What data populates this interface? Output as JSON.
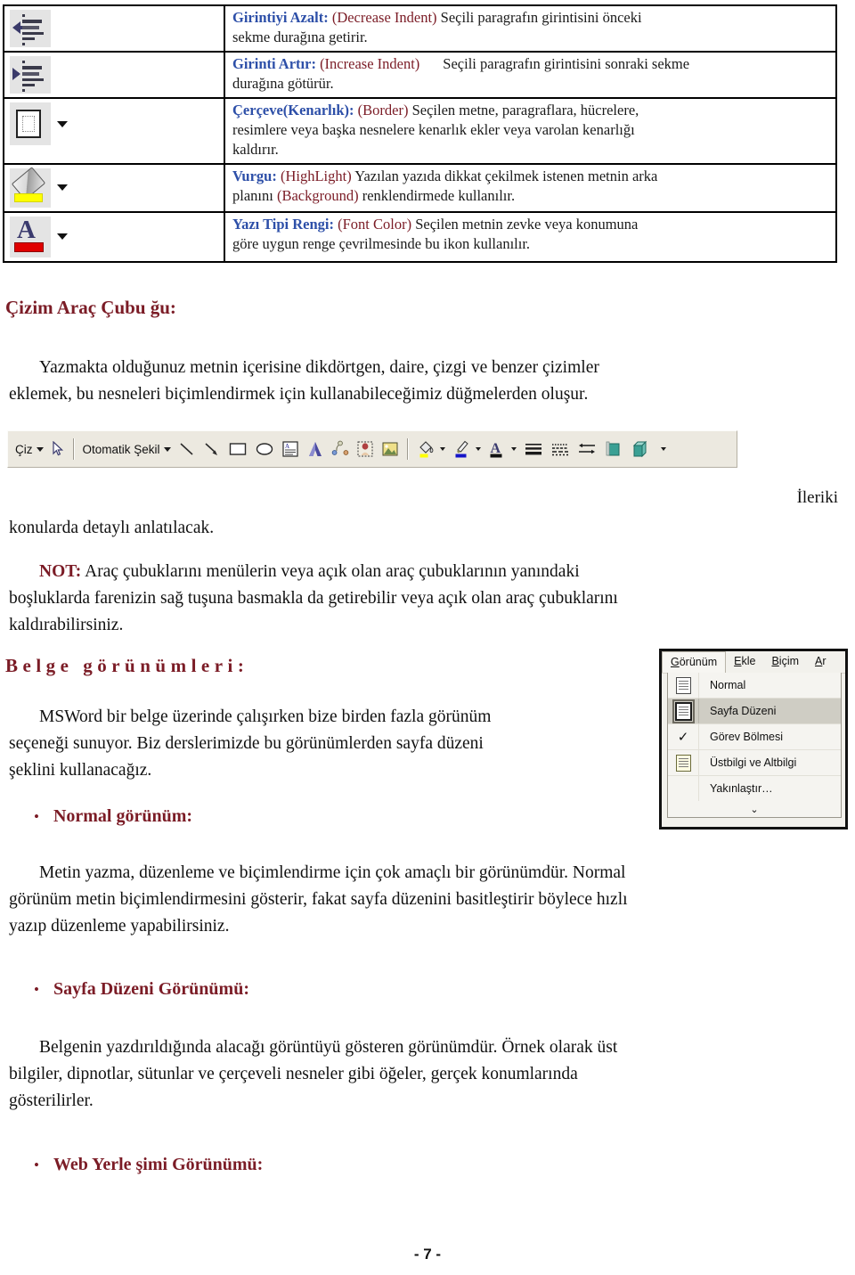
{
  "icon_table": {
    "rows": [
      {
        "icon": "decrease-indent-icon",
        "label_tr": "Girintiyi Azalt:",
        "label_en": "(Decrease Indent)",
        "desc_part1": " Seçili paragrafın girintisini önceki",
        "desc_part2": "sekme durağına getirir.",
        "has_caret": false
      },
      {
        "icon": "increase-indent-icon",
        "label_tr": "Girinti Artır:",
        "label_en": "(Increase Indent)",
        "desc_part1": "Seçili paragrafın girintisini sonraki sekme",
        "desc_part2": "durağına götürür.",
        "has_caret": false,
        "wide_gap": true
      },
      {
        "icon": "border-icon",
        "label_tr": "Çerçeve(Kenarlık):",
        "label_en": "(Border)",
        "desc_part1": " Seçilen metne, paragraflara, hücrelere,",
        "desc_part2": "resimlere veya başka nesnelere kenarlık ekler veya varolan kenarlığı",
        "desc_part3": "kaldırır.",
        "has_caret": true
      },
      {
        "icon": "highlight-icon",
        "label_tr": "Vurgu:",
        "label_en": "(HighLight)",
        "desc_part1": " Yazılan yazıda dikkat çekilmek istenen metnin arka",
        "desc_part2_pre": "planını ",
        "desc_part2_red": "(Background)",
        "desc_part2_post": " renklendirmede kullanılır.",
        "has_caret": true
      },
      {
        "icon": "font-color-icon",
        "label_tr": "Yazı Tipi Rengi:",
        "label_en": "(Font Color)",
        "desc_part1": " Seçilen metnin zevke veya konumuna",
        "desc_part2": "göre uygun renge çevrilmesinde bu ikon kullanılır.",
        "has_caret": true
      }
    ]
  },
  "sections": {
    "drawing_heading": "Çizim Araç Çubu ğu:",
    "drawing_para_line1": "Yazmakta olduğunuz metnin içerisine dikdörtgen, daire, çizgi ve benzer çizimler",
    "drawing_para_line2": "eklemek, bu nesneleri biçimlendirmek için kullanabileceğimiz düğmelerden oluşur.",
    "ileriki": "İleriki",
    "konularda": "konularda detaylı anlatılacak.",
    "not_label": "NOT:",
    "not_line1": " Araç çubuklarını menülerin veya açık olan araç çubuklarının yanındaki",
    "not_line2": "boşluklarda farenizin sağ tuşuna basmakla da getirebilir veya açık olan araç çubuklarını",
    "not_line3": "kaldırabilirsiniz.",
    "belge_heading": "Belge görünümleri:",
    "belge_line1": "MSWord bir belge üzerinde çalışırken bize birden fazla görünüm",
    "belge_line2": "seçeneği sunuyor. Biz derslerimizde bu görünümlerden sayfa düzeni",
    "belge_line3": "şeklini kullanacağız.",
    "normal_bullet": "Normal görünüm:",
    "normal_line1": "Metin yazma, düzenleme ve biçimlendirme için çok amaçlı bir görünümdür. Normal",
    "normal_line2": "görünüm metin biçimlendirmesini gösterir, fakat sayfa düzenini basitleştirir böylece hızlı",
    "normal_line3": "yazıp düzenleme yapabilirsiniz.",
    "sayfa_bullet": "Sayfa Düzeni Görünümü:",
    "sayfa_line1": "Belgenin yazdırıldığında alacağı görüntüyü gösteren görünümdür.  Örnek olarak üst",
    "sayfa_line2": "bilgiler, dipnotlar, sütunlar ve çerçeveli nesneler gibi öğeler, gerçek konumlarında",
    "sayfa_line3": "gösterilirler.",
    "web_bullet": "Web Yerle şimi Görünümü:",
    "bullet_char": "•"
  },
  "drawing_toolbar": {
    "draw_label": "Çiz",
    "autoshape_label": "Otomatik Şekil",
    "icons": [
      "select-arrow-icon",
      "line-icon",
      "arrow-icon",
      "rectangle-icon",
      "ellipse-icon",
      "text-box-icon",
      "wordart-icon",
      "diagram-icon",
      "clip-art-icon",
      "picture-icon",
      "fill-color-icon",
      "line-color-icon",
      "font-color-icon",
      "line-style-icon",
      "dash-style-icon",
      "arrow-style-icon",
      "shadow-style-icon",
      "3d-style-icon"
    ]
  },
  "view_menu": {
    "tabs": [
      {
        "label": "Görünüm",
        "accel": "G",
        "active": true
      },
      {
        "label": "Ekle",
        "accel": "E",
        "active": false
      },
      {
        "label": "Biçim",
        "accel": "B",
        "active": false
      },
      {
        "label": "Ar",
        "accel": "A",
        "active": false
      }
    ],
    "items": [
      {
        "label": "Normal",
        "icon": "normal-view-icon",
        "selected": false,
        "checked": false
      },
      {
        "label": "Sayfa Düzeni",
        "icon": "page-layout-view-icon",
        "selected": true,
        "checked": false
      },
      {
        "label": "Görev Bölmesi",
        "icon": "checkmark-icon",
        "selected": false,
        "checked": true
      },
      {
        "label": "Üstbilgi ve Altbilgi",
        "icon": "header-footer-icon",
        "selected": false,
        "checked": false
      },
      {
        "label": "Yakınlaştır…",
        "icon": "",
        "selected": false,
        "checked": false
      }
    ],
    "expand_chevron": "⌄"
  },
  "footer": {
    "page_number": "- 7 -"
  },
  "colors": {
    "heading_red": "#7b1c26",
    "label_blue": "#2d4fa8",
    "english_red": "#7b1c26",
    "body_black": "#111111",
    "toolbar_bg": "#ece9e0"
  }
}
